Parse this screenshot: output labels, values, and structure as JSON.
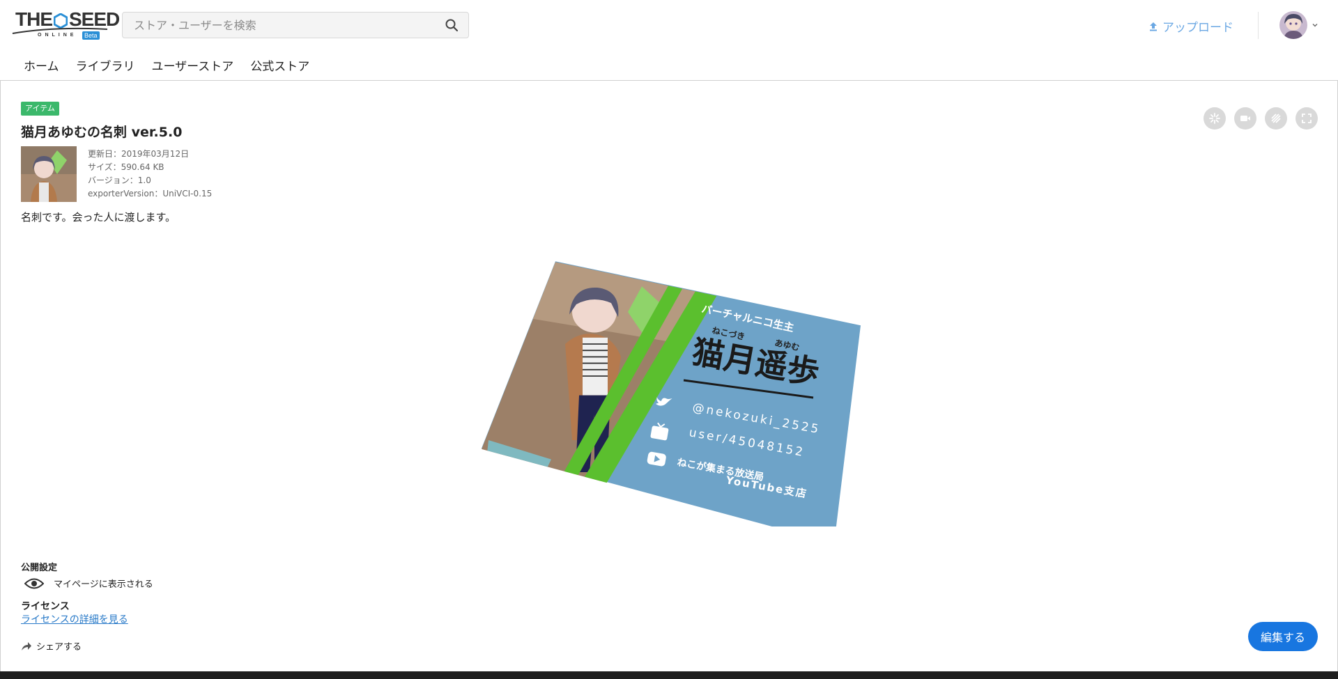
{
  "header": {
    "logo_main_left": "THE",
    "logo_main_right": "SEED",
    "logo_sub": "ONLINE",
    "logo_beta": "Beta",
    "search_placeholder": "ストア・ユーザーを検索",
    "upload_label": "アップロード"
  },
  "nav": {
    "items": [
      {
        "label": "ホーム"
      },
      {
        "label": "ライブラリ"
      },
      {
        "label": "ユーザーストア"
      },
      {
        "label": "公式ストア"
      }
    ]
  },
  "item": {
    "badge": "アイテム",
    "title": "猫月あゆむの名刺 ver.5.0",
    "updated": "更新日：2019年03月12日",
    "size": "サイズ：590.64 KB",
    "version": "バージョン：1.0",
    "exporter": "exporterVersion：UniVCI-0.15",
    "description": "名刺です。会った人に渡します。"
  },
  "card_art": {
    "subtitle": "バーチャルニコ生主",
    "ruby_left": "ねこづき",
    "ruby_right": "あゆむ",
    "name": "猫月遥歩",
    "twitter": "@nekozuki_2525",
    "niconico": "user/45048152",
    "youtube_line1": "ねこが集まる放送局",
    "youtube_line2": "YouTube支店"
  },
  "viewer_controls": [
    {
      "icon": "sparkle-icon"
    },
    {
      "icon": "video-camera-icon"
    },
    {
      "icon": "stripes-icon"
    },
    {
      "icon": "fullscreen-icon"
    }
  ],
  "visibility": {
    "heading": "公開設定",
    "label": "マイページに表示される"
  },
  "license": {
    "heading": "ライセンス",
    "link": "ライセンスの詳細を見る"
  },
  "share_label": "シェアする",
  "edit_label": "編集する",
  "colors": {
    "accent": "#1876e0",
    "badge": "#3bb86b",
    "upload": "#6aa7e3",
    "card_blue": "#6ea3c8",
    "card_green": "#5bbf2e"
  }
}
